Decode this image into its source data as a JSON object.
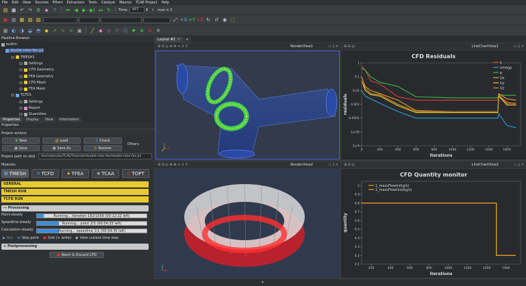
{
  "menu": [
    "File",
    "Edit",
    "View",
    "Sources",
    "Filters",
    "Extractors",
    "Tools",
    "Catalyst",
    "Macros",
    "TCAE Project",
    "Help"
  ],
  "toolbar": {
    "time_label": "Time:",
    "time_value": "457",
    "step_value": "8",
    "max_label": "max is 3"
  },
  "pipeline": {
    "title": "Pipeline Browser",
    "items": [
      {
        "label": "builtin:"
      },
      {
        "label": "double-rotor-fan-p1"
      },
      {
        "label": "TMESH1"
      },
      {
        "label": "Settings"
      },
      {
        "label": "CFD Geometry"
      },
      {
        "label": "FEA Geometry"
      },
      {
        "label": "CFD Mesh"
      },
      {
        "label": "FEA Mesh"
      },
      {
        "label": "TCFD1"
      },
      {
        "label": "Settings"
      },
      {
        "label": "Report"
      },
      {
        "label": "Quantities"
      }
    ]
  },
  "props": {
    "tabs": [
      "Properties",
      "Display",
      "View",
      "Information"
    ],
    "title": "Properties",
    "project_actions": "Project actions",
    "buttons": {
      "new": "New",
      "load": "Load",
      "check": "Check",
      "save": "Save",
      "save_as": "Save As",
      "restore": "Restore",
      "others": "Others"
    },
    "path_label": "Project path on disk",
    "path_value": "/home/jeczay/TCAE/Tutorials/double-rotor-fan/double-rotor-fan.p1",
    "modules_label": "Modules",
    "module_tabs": [
      "TMESH",
      "TCFD",
      "TFEA",
      "TCAA",
      "TOPT"
    ],
    "sections": {
      "general": "GENERAL",
      "tmesh_run": "TMESH RUN",
      "tcfd_run": "TCFD RUN",
      "processing": "Processing",
      "postprocessing": "Postprocessing"
    },
    "progress": [
      {
        "label": "Point-steady",
        "text": "Running... iteration 182/1500 (00:12:22 left)",
        "fraction": 0.06
      },
      {
        "label": "Speedline-steady",
        "text": "Running... point 2/5 (00:54:35 left)",
        "fraction": 0.2
      },
      {
        "label": "Calculation-steady",
        "text": "Running... speedline 1/1 (00:54:35 left)",
        "fraction": 0.2
      }
    ],
    "run_actions": {
      "run": "Run",
      "skip": "Skip point",
      "quit": "Quit (+ write)",
      "view": "View current time step"
    },
    "abort": "Abort & Discard CFD"
  },
  "layout_tab": "Layout #1",
  "views": {
    "render1": "RenderView1",
    "chart1": "LineChartView1",
    "render2": "RenderView2",
    "chart2": "LineChartView2"
  },
  "colors": {
    "accent_yellow": "#e8c930",
    "progress_blue": "#3a8fd8",
    "abort_red": "#d33"
  },
  "chart_data": [
    {
      "type": "line",
      "title": "CFD Residuals",
      "xlabel": "iterations",
      "ylabel": "residuals",
      "xlim": [
        0,
        1750
      ],
      "ylim_log10": [
        -6,
        0
      ],
      "yscale": "log",
      "yticks": [
        "1",
        "0.1",
        "0.01",
        "0.001",
        "0.0001",
        "1e-05",
        "1e-6"
      ],
      "xticks": [
        "0",
        "200",
        "400",
        "600",
        "800",
        "1000",
        "1200",
        "1400",
        "1600"
      ],
      "legend": "top-right",
      "series": [
        {
          "name": "k",
          "color": "#e03c3c",
          "x": [
            0,
            40,
            100,
            200,
            400,
            600,
            1000,
            1500,
            1510,
            1600,
            1700
          ],
          "y": [
            0.6,
            0.3,
            0.05,
            0.03,
            0.0035,
            0.002,
            0.002,
            0.002,
            0.0035,
            0.0015,
            0.001
          ]
        },
        {
          "name": "omega",
          "color": "#2aa0d8",
          "x": [
            0,
            40,
            100,
            200,
            400,
            600,
            1000,
            1500,
            1510,
            1600,
            1700
          ],
          "y": [
            0.01,
            0.004,
            0.0025,
            0.0012,
            0.0003,
            0.0001,
            0.0001,
            0.0001,
            0.0002,
            3e-05,
            2e-05
          ]
        },
        {
          "name": "p",
          "color": "#3ab94a",
          "x": [
            0,
            40,
            100,
            200,
            400,
            600,
            1000,
            1500,
            1510,
            1600,
            1700
          ],
          "y": [
            0.4,
            0.3,
            0.1,
            0.04,
            0.02,
            0.0035,
            0.003,
            0.003,
            0.005,
            0.0045,
            0.0045
          ]
        },
        {
          "name": "Ux",
          "color": "#e89a2a",
          "x": [
            0,
            40,
            100,
            200,
            400,
            600,
            1000,
            1500,
            1510,
            1600,
            1700
          ],
          "y": [
            0.1,
            0.02,
            0.01,
            0.006,
            0.002,
            0.00035,
            0.0003,
            0.0003,
            0.006,
            0.0025,
            0.002
          ]
        },
        {
          "name": "Uy",
          "color": "#e8d030",
          "x": [
            0,
            40,
            100,
            200,
            400,
            600,
            1000,
            1500,
            1510,
            1600,
            1700
          ],
          "y": [
            0.05,
            0.01,
            0.005,
            0.004,
            0.0008,
            0.00025,
            0.00025,
            0.00025,
            0.004,
            0.0009,
            0.0009
          ]
        },
        {
          "name": "Uz",
          "color": "#d8902a",
          "x": [
            0,
            40,
            100,
            200,
            400,
            600,
            1000,
            1500,
            1510,
            1600,
            1700
          ],
          "y": [
            0.05,
            0.015,
            0.006,
            0.005,
            0.001,
            0.0003,
            0.0003,
            0.0003,
            0.005,
            0.0012,
            0.0012
          ]
        }
      ]
    },
    {
      "type": "line",
      "title": "CFD Quantity monitor",
      "xlabel": "iterations",
      "ylabel": "quantity",
      "xlim": [
        100,
        1750
      ],
      "ylim": [
        4.1,
        5.05
      ],
      "yticks": [
        "5",
        "4.9",
        "4.8",
        "4.7",
        "4.6",
        "4.5",
        "4.4",
        "4.3",
        "4.2",
        "4.1"
      ],
      "xticks": [
        "200",
        "400",
        "600",
        "800",
        "1000",
        "1200",
        "1400",
        "1600"
      ],
      "legend": "top-left",
      "series": [
        {
          "name": "1_massFlowIn(kg/s)",
          "color": "#e8a020",
          "x": [
            100,
            1500,
            1500,
            1510,
            1700
          ],
          "y": [
            4.8,
            4.8,
            4.2,
            4.2,
            4.2
          ]
        },
        {
          "name": "1_massFlowOut(kg/s)",
          "color": "#e8a020",
          "x": [
            100,
            1500,
            1500,
            1510,
            1700
          ],
          "y": [
            4.8,
            4.8,
            4.2,
            4.2,
            4.2
          ]
        }
      ]
    }
  ]
}
